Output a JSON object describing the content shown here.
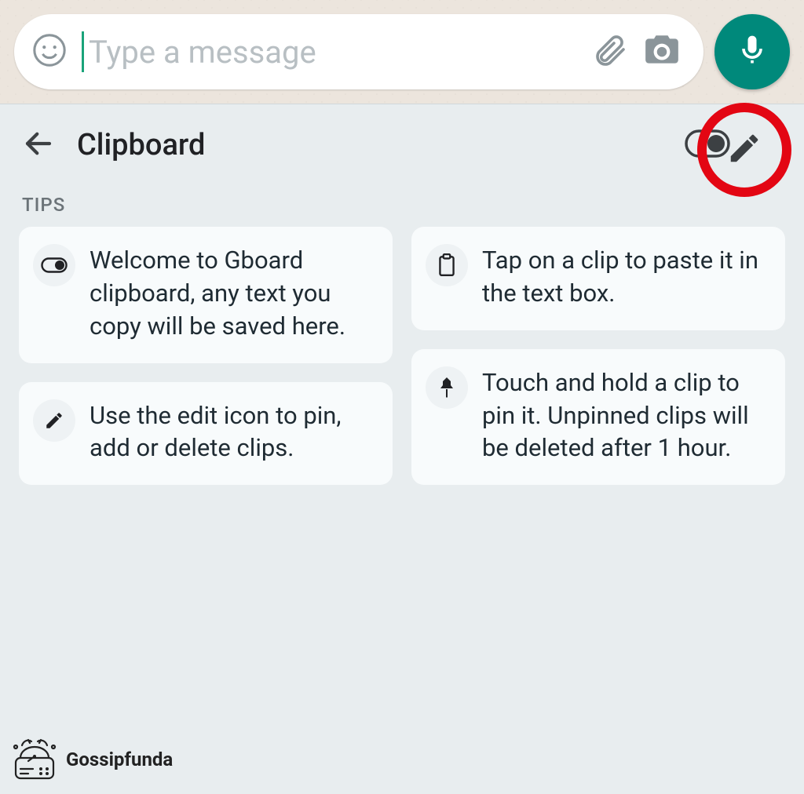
{
  "wa_input": {
    "placeholder": "Type a message"
  },
  "clipboard": {
    "title": "Clipboard",
    "section_label": "TIPS",
    "tips": {
      "welcome": "Welcome to Gboard clipboard, any text you copy will be saved here.",
      "edit": "Use the edit icon to pin, add or delete clips.",
      "tap": "Tap on a clip to paste it in the text box.",
      "pin": "Touch and hold a clip to pin it. Unpinned clips will be deleted after 1 hour."
    }
  },
  "watermark": "Gossipfunda",
  "colors": {
    "accent_green": "#00897b",
    "cursor": "#1aa37a",
    "highlight_ring": "#e30613"
  }
}
